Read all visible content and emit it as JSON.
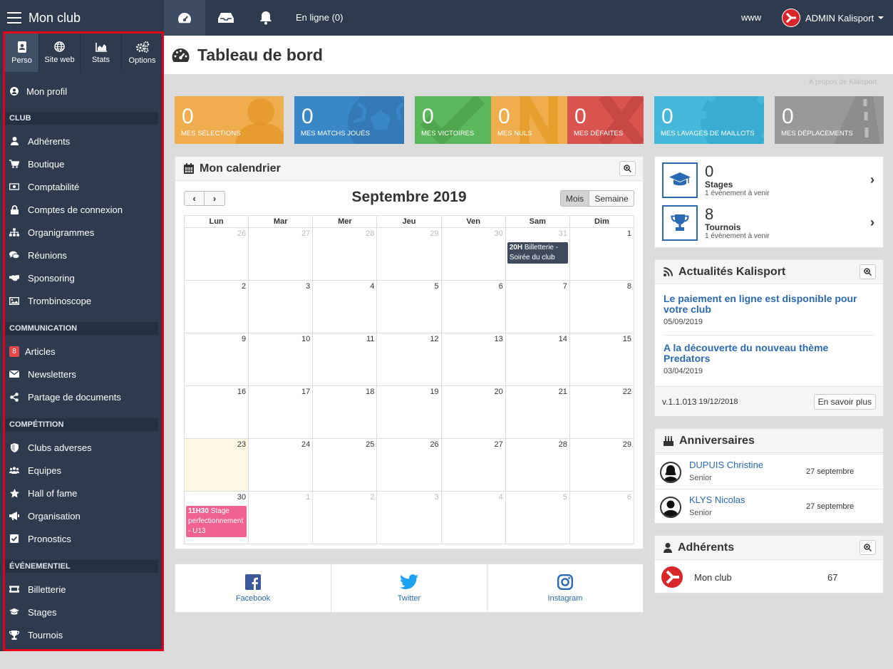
{
  "app": {
    "title": "Mon club",
    "online": "En ligne (0)",
    "www": "www",
    "user": "ADMIN Kalisport"
  },
  "sidebar": {
    "tabs": [
      {
        "label": "Perso",
        "icon": "address-book-icon"
      },
      {
        "label": "Site web",
        "icon": "globe-icon"
      },
      {
        "label": "Stats",
        "icon": "area-chart-icon"
      },
      {
        "label": "Options",
        "icon": "cogs-icon"
      }
    ],
    "profile": "Mon profil",
    "sections": {
      "club": "CLUB",
      "communication": "COMMUNICATION",
      "competition": "COMPÉTITION",
      "evenementiel": "ÉVÉNEMENTIEL"
    },
    "club_items": [
      "Adhérents",
      "Boutique",
      "Comptabilité",
      "Comptes de connexion",
      "Organigrammes",
      "Réunions",
      "Sponsoring",
      "Trombinoscope"
    ],
    "communication_items": [
      "Articles",
      "Newsletters",
      "Partage de documents"
    ],
    "articles_badge": "8",
    "competition_items": [
      "Clubs adverses",
      "Equipes",
      "Hall of fame",
      "Organisation",
      "Pronostics"
    ],
    "evenementiel_items": [
      "Billetterie",
      "Stages",
      "Tournois"
    ]
  },
  "page": {
    "title": "Tableau de bord",
    "apropos": "A propos de Kalisport"
  },
  "tiles": [
    {
      "value": "0",
      "caption": "MES SÉLECTIONS",
      "color": "#f0ad4e"
    },
    {
      "value": "0",
      "caption": "MES MATCHS JOUÉS",
      "color": "#3a87c8"
    },
    {
      "value": "0",
      "caption": "MES VICTOIRES",
      "color": "#5cb85c"
    },
    {
      "value": "0",
      "caption": "MES NULS",
      "color": "#f0ad4e"
    },
    {
      "value": "0",
      "caption": "MES DÉFAITES",
      "color": "#d9534f"
    },
    {
      "value": "0",
      "caption": "MES LAVAGES DE MAILLOTS",
      "color": "#46b8da"
    },
    {
      "value": "0",
      "caption": "MES DÉPLACEMENTS",
      "color": "#999999"
    }
  ],
  "calendar": {
    "title": "Mon calendrier",
    "month": "Septembre 2019",
    "view_month": "Mois",
    "view_week": "Semaine",
    "days": [
      "Lun",
      "Mar",
      "Mer",
      "Jeu",
      "Ven",
      "Sam",
      "Dim"
    ],
    "weeks": [
      [
        "26",
        "27",
        "28",
        "29",
        "30",
        "31",
        "1"
      ],
      [
        "2",
        "3",
        "4",
        "5",
        "6",
        "7",
        "8"
      ],
      [
        "9",
        "10",
        "11",
        "12",
        "13",
        "14",
        "15"
      ],
      [
        "16",
        "17",
        "18",
        "19",
        "20",
        "21",
        "22"
      ],
      [
        "23",
        "24",
        "25",
        "26",
        "27",
        "28",
        "29"
      ],
      [
        "30",
        "1",
        "2",
        "3",
        "4",
        "5",
        "6"
      ]
    ],
    "event1": {
      "time": "20H",
      "text": "Billetterie - Soirée du club"
    },
    "event2": {
      "time": "11H30",
      "text": "Stage perfectionnement - U13"
    }
  },
  "social": {
    "facebook": "Facebook",
    "twitter": "Twitter",
    "instagram": "Instagram"
  },
  "summary": {
    "stages": {
      "count": "0",
      "label": "Stages",
      "sub": "1 évènement à venir"
    },
    "tournois": {
      "count": "8",
      "label": "Tournois",
      "sub": "1 évènement à venir"
    }
  },
  "news": {
    "title": "Actualités Kalisport",
    "items": [
      {
        "title": "Le paiement en ligne est disponible pour votre club",
        "date": "05/09/2019"
      },
      {
        "title": "A la découverte du nouveau thème Predators",
        "date": "03/04/2019"
      }
    ],
    "version": "v.1.1.013",
    "version_date": "19/12/2018",
    "more": "En savoir plus"
  },
  "birthdays": {
    "title": "Anniversaires",
    "items": [
      {
        "name": "DUPUIS Christine",
        "role": "Senior",
        "date": "27 septembre"
      },
      {
        "name": "KLYS Nicolas",
        "role": "Senior",
        "date": "27 septembre"
      }
    ]
  },
  "members": {
    "title": "Adhérents",
    "club": "Mon club",
    "count": "67"
  }
}
